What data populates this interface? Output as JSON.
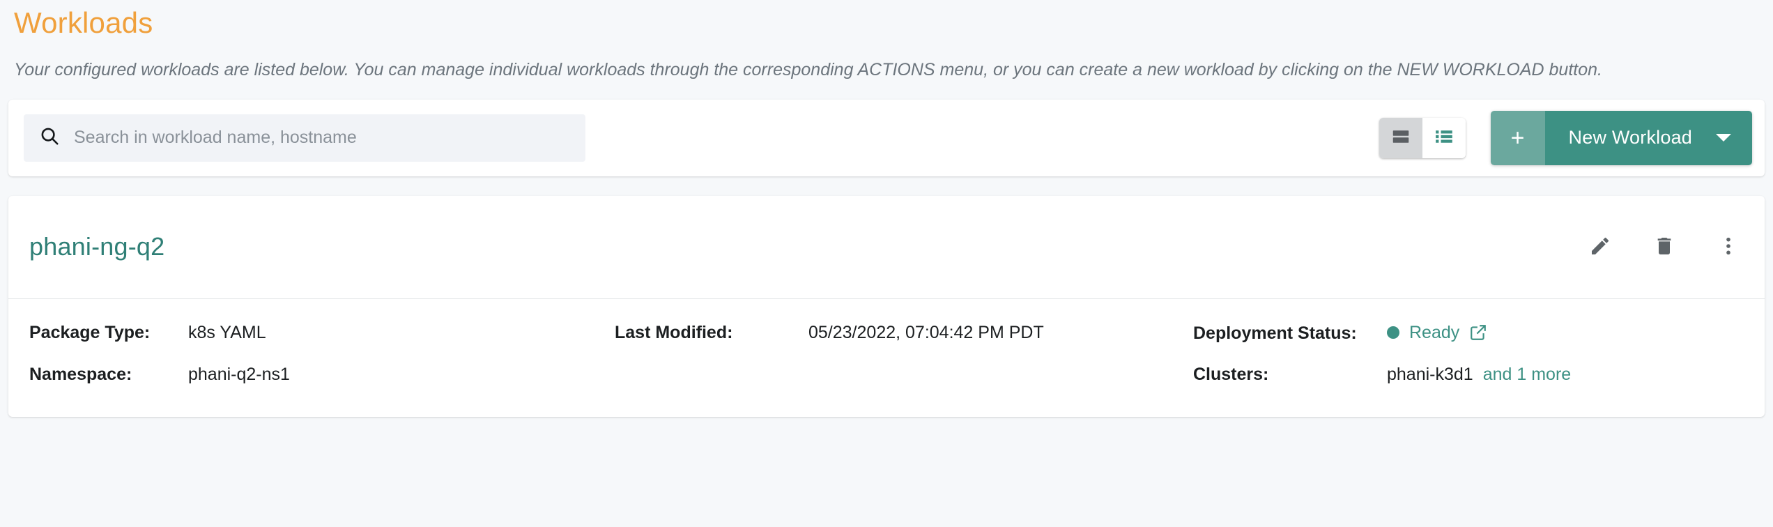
{
  "header": {
    "title": "Workloads",
    "subtitle": "Your configured workloads are listed below. You can manage individual workloads through the corresponding ACTIONS menu, or you can create a new workload by clicking on the NEW WORKLOAD button."
  },
  "toolbar": {
    "search": {
      "placeholder": "Search in workload name, hostname",
      "value": "",
      "icon": "search-icon"
    },
    "view_toggle": {
      "card_view": {
        "icon": "card-view-icon",
        "selected": true
      },
      "list_view": {
        "icon": "list-view-icon",
        "selected": false
      }
    },
    "new_workload": {
      "plus_label": "+",
      "label": "New Workload",
      "caret_icon": "chevron-down-icon"
    }
  },
  "workload": {
    "name": "phani-ng-q2",
    "actions": {
      "edit": "edit-pencil-icon",
      "delete": "trash-icon",
      "more": "more-vertical-icon"
    },
    "fields": {
      "package_type_label": "Package Type:",
      "package_type_value": "k8s YAML",
      "namespace_label": "Namespace:",
      "namespace_value": "phani-q2-ns1",
      "last_modified_label": "Last Modified:",
      "last_modified_value": "05/23/2022, 07:04:42 PM PDT",
      "deployment_status_label": "Deployment Status:",
      "deployment_status_value": "Ready",
      "clusters_label": "Clusters:",
      "clusters_value": "phani-k3d1",
      "clusters_more": "and 1 more"
    }
  },
  "colors": {
    "title_orange": "#f0a03c",
    "teal": "#3d9184",
    "teal_light": "#6ba89e",
    "teal_title": "#2f7f76",
    "page_bg": "#f6f8fa",
    "status_ready": "#3d9184"
  }
}
